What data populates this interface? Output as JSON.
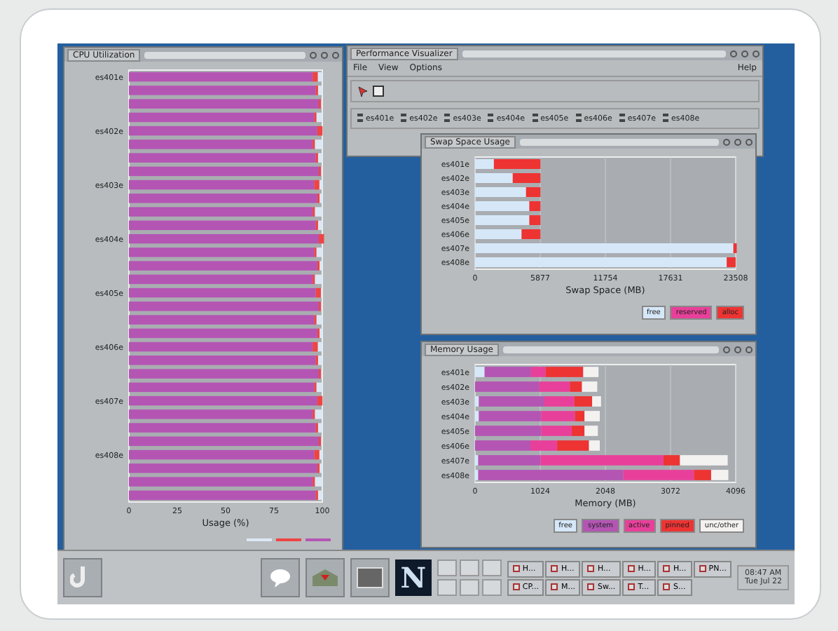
{
  "cpu_window": {
    "title": "CPU Utilization",
    "host_labels": [
      "es401e",
      "es402e",
      "es403e",
      "es404e",
      "es405e",
      "es406e",
      "es407e",
      "es408e"
    ],
    "tick_labels": [
      "0",
      "25",
      "50",
      "75",
      "100"
    ],
    "xlabel": "Usage (%)"
  },
  "perf_window": {
    "title": "Performance Visualizer",
    "menus": [
      {
        "label": "File"
      },
      {
        "label": "View"
      },
      {
        "label": "Options"
      }
    ],
    "help_menu": "Help",
    "hosts": [
      {
        "label": "es401e"
      },
      {
        "label": "es402e"
      },
      {
        "label": "es403e"
      },
      {
        "label": "es404e"
      },
      {
        "label": "es405e"
      },
      {
        "label": "es406e"
      },
      {
        "label": "es407e"
      },
      {
        "label": "es408e"
      }
    ]
  },
  "swap_window": {
    "title": "Swap Space Usage",
    "chart_data": {
      "type": "bar",
      "orientation": "horizontal",
      "stacked": true,
      "xlabel": "Swap Space (MB)",
      "grid": true,
      "xlim": [
        0,
        23508
      ],
      "xticks": [
        0,
        5877,
        11754,
        17631,
        23508
      ],
      "categories": [
        "es401e",
        "es402e",
        "es403e",
        "es404e",
        "es405e",
        "es406e",
        "es407e",
        "es408e"
      ],
      "series": [
        {
          "name": "free",
          "color": "#d6e8f8",
          "values": [
            1700,
            3400,
            4600,
            4900,
            4900,
            4200,
            23300,
            22700
          ]
        },
        {
          "name": "reserved",
          "color": "#e8409a",
          "values": [
            0,
            0,
            0,
            0,
            0,
            0,
            0,
            0
          ]
        },
        {
          "name": "alloc",
          "color": "#ee3333",
          "values": [
            4200,
            2500,
            1300,
            1000,
            1000,
            1700,
            300,
            800
          ]
        }
      ]
    }
  },
  "memory_window": {
    "title": "Memory Usage",
    "chart_data": {
      "type": "bar",
      "orientation": "horizontal",
      "stacked": true,
      "xlabel": "Memory (MB)",
      "grid": true,
      "xlim": [
        0,
        4096
      ],
      "xticks": [
        0,
        1024,
        2048,
        3072,
        4096
      ],
      "categories": [
        "es401e",
        "es402e",
        "es403e",
        "es404e",
        "es405e",
        "es406e",
        "es407e",
        "es408e"
      ],
      "series": [
        {
          "name": "free",
          "color": "#d6e8f8",
          "values": [
            150,
            null,
            60,
            60,
            null,
            null,
            50,
            50
          ]
        },
        {
          "name": "system",
          "color": "#b455b4",
          "values": [
            730,
            1010,
            1030,
            980,
            1040,
            870,
            980,
            2280
          ]
        },
        {
          "name": "active",
          "color": "#e8409a",
          "values": [
            230,
            480,
            470,
            530,
            480,
            420,
            1930,
            1110
          ]
        },
        {
          "name": "pinned",
          "color": "#ee3333",
          "values": [
            590,
            190,
            280,
            150,
            200,
            500,
            260,
            270
          ]
        },
        {
          "name": "unc/other",
          "color": "#f4f2f0",
          "values": [
            240,
            240,
            140,
            240,
            210,
            170,
            750,
            270
          ]
        }
      ]
    }
  },
  "taskbar": {
    "logo_letter": "N",
    "tasks": [
      {
        "label": "H..."
      },
      {
        "label": "H..."
      },
      {
        "label": "H..."
      },
      {
        "label": "H..."
      },
      {
        "label": "H..."
      },
      {
        "label": "PN..."
      },
      {
        "label": "CP..."
      },
      {
        "label": "M..."
      },
      {
        "label": "Sw..."
      },
      {
        "label": "T..."
      },
      {
        "label": "S..."
      }
    ],
    "time": "08:47 AM",
    "date": "Tue Jul 22"
  }
}
